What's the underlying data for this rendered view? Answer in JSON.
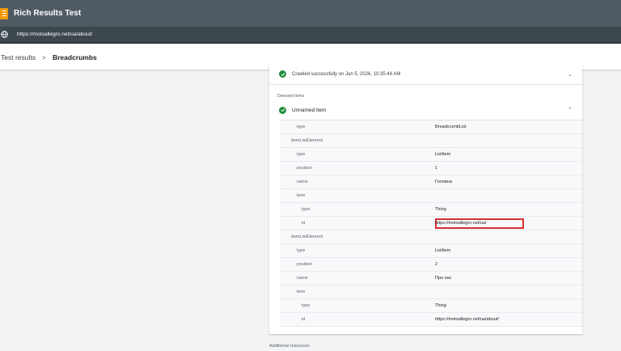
{
  "app": {
    "title": "Rich Results Test"
  },
  "url": "https://motoallegro.net/ua/about/",
  "breadcrumb": {
    "root": "Test results",
    "separator": ">",
    "current": "Breadcrumbs"
  },
  "crawl": {
    "status": "Crawled successfully on Jun 5, 2026, 10:35:44 AM"
  },
  "detected": {
    "label": "Detected items",
    "item_name": "Unnamed item",
    "properties": [
      {
        "key": "type",
        "value": "BreadcrumbList",
        "level": 1
      },
      {
        "key": "itemListElement",
        "value": "",
        "level": 0
      },
      {
        "key": "type",
        "value": "ListItem",
        "level": 1
      },
      {
        "key": "position",
        "value": "1",
        "level": 1
      },
      {
        "key": "name",
        "value": "Головна",
        "level": 1
      },
      {
        "key": "item",
        "value": "",
        "level": 1
      },
      {
        "key": "type",
        "value": "Thing",
        "level": 2
      },
      {
        "key": "id",
        "value": "https://motoallegro.net/ua/",
        "level": 2,
        "highlighted": true
      },
      {
        "key": "itemListElement",
        "value": "",
        "level": 0
      },
      {
        "key": "type",
        "value": "ListItem",
        "level": 1
      },
      {
        "key": "position",
        "value": "2",
        "level": 1
      },
      {
        "key": "name",
        "value": "Про нас",
        "level": 1
      },
      {
        "key": "item",
        "value": "",
        "level": 1
      },
      {
        "key": "type",
        "value": "Thing",
        "level": 2
      },
      {
        "key": "id",
        "value": "https://motoallegro.net/ua/about/",
        "level": 2
      }
    ]
  },
  "additional": {
    "label": "Additional resources"
  },
  "icons": {
    "app": "list-icon",
    "url": "globe-icon",
    "status": "check-circle-icon",
    "crawl_toggle": "chevron-down-icon",
    "item_toggle": "chevron-up-icon"
  },
  "colors": {
    "accent": "#f29900",
    "success": "#1e8e3e",
    "highlight": "#d32f2f",
    "topbar": "#4f5b62"
  }
}
